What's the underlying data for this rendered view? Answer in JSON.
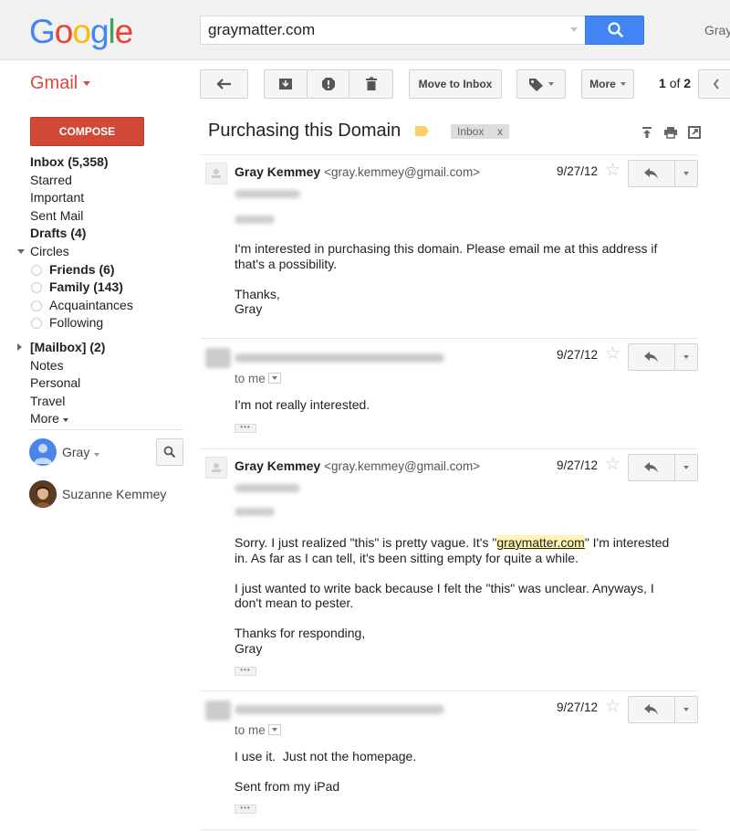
{
  "header": {
    "logo_letters": [
      "G",
      "o",
      "o",
      "g",
      "l",
      "e"
    ],
    "logo_colors": [
      "#4285f4",
      "#ea4335",
      "#fbbc05",
      "#4285f4",
      "#34a853",
      "#ea4335"
    ],
    "search_value": "graymatter.com",
    "user_truncated": "Gray"
  },
  "toolbar": {
    "app_label": "Gmail",
    "move_to_inbox": "Move to Inbox",
    "more": "More",
    "pager_current": "1",
    "pager_of": "of",
    "pager_total": "2"
  },
  "sidebar": {
    "compose": "COMPOSE",
    "items": [
      {
        "label": "Inbox (5,358)",
        "bold": true
      },
      {
        "label": "Starred"
      },
      {
        "label": "Important"
      },
      {
        "label": "Sent Mail"
      },
      {
        "label": "Drafts (4)",
        "bold": true
      },
      {
        "label": "Circles"
      },
      {
        "label": "Friends (6)",
        "bold": true
      },
      {
        "label": "Family (143)",
        "bold": true
      },
      {
        "label": "Acquaintances"
      },
      {
        "label": "Following"
      },
      {
        "label": "[Mailbox] (2)",
        "bold": true
      },
      {
        "label": "Notes"
      },
      {
        "label": "Personal"
      },
      {
        "label": "Travel"
      },
      {
        "label": "More"
      }
    ],
    "hangouts_user": "Gray",
    "contact": "Suzanne Kemmey"
  },
  "thread": {
    "subject": "Purchasing this Domain",
    "label_chip": "Inbox",
    "label_chip_close": "x",
    "messages": [
      {
        "sender_name": "Gray Kemmey",
        "sender_email": "<gray.kemmey@gmail.com>",
        "date": "9/27/12",
        "paragraphs": [
          "I'm interested in purchasing this domain. Please email me at this address if that's a possibility.",
          "Thanks,\nGray"
        ]
      },
      {
        "date": "9/27/12",
        "to": "to me",
        "paragraphs": [
          "I'm not really interested."
        ]
      },
      {
        "sender_name": "Gray Kemmey",
        "sender_email": "<gray.kemmey@gmail.com>",
        "date": "9/27/12",
        "p1_before": "Sorry. I just realized \"this\" is pretty vague. It's \"",
        "p1_link": "graymatter.com",
        "p1_after": "\" I'm interested in. As far as I can tell, it's been sitting empty for quite a while.",
        "paragraphs": [
          "I just wanted to write back because I felt the \"this\" was unclear. Anyways, I don't mean to pester.",
          "Thanks for responding,\nGray"
        ]
      },
      {
        "date": "9/27/12",
        "to": "to me",
        "paragraphs": [
          "I use it.  Just not the homepage.",
          "Sent from my iPad"
        ]
      }
    ],
    "trim_dots": "•••"
  }
}
